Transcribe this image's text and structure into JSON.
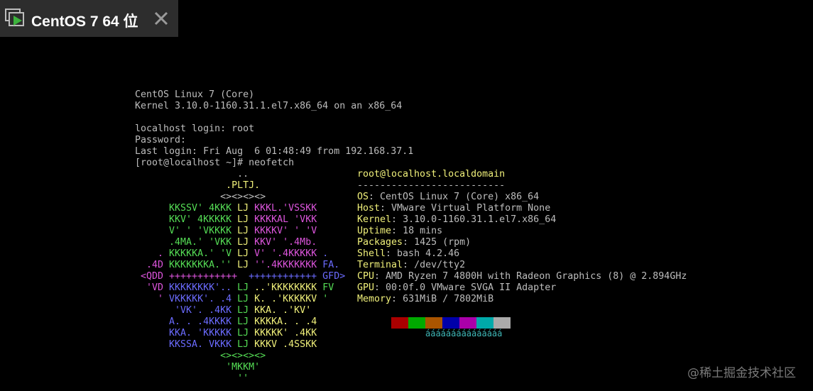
{
  "tab": {
    "title": "CentOS 7 64 位"
  },
  "console": {
    "boot": [
      "CentOS Linux 7 (Core)",
      "Kernel 3.10.0-1160.31.1.el7.x86_64 on an x86_64",
      "localhost login: root",
      "Password:",
      "Last login: Fri Aug  6 01:48:49 from 192.168.37.1",
      "[root@localhost ~]# neofetch"
    ],
    "logo": [
      [
        {
          "c": "gw",
          "t": "                  .."
        }
      ],
      [
        {
          "c": "yel",
          "t": "                .PLTJ."
        }
      ],
      [
        {
          "c": "gw",
          "t": "               <><><><>"
        }
      ],
      [
        {
          "c": "green",
          "t": "      KKSSV' 4KKK "
        },
        {
          "c": "yel",
          "t": "LJ "
        },
        {
          "c": "mag",
          "t": "KKKL.'VSSKK"
        }
      ],
      [
        {
          "c": "green",
          "t": "      KKV' 4KKKKK "
        },
        {
          "c": "yel",
          "t": "LJ "
        },
        {
          "c": "mag",
          "t": "KKKKAL 'VKK"
        }
      ],
      [
        {
          "c": "green",
          "t": "      V' ' 'VKKKK "
        },
        {
          "c": "yel",
          "t": "LJ "
        },
        {
          "c": "mag",
          "t": "KKKKV' ' 'V"
        }
      ],
      [
        {
          "c": "green",
          "t": "      .4MA.' 'VKK "
        },
        {
          "c": "yel",
          "t": "LJ "
        },
        {
          "c": "mag",
          "t": "KKV' '.4Mb."
        }
      ],
      [
        {
          "c": "mag",
          "t": "    . "
        },
        {
          "c": "green",
          "t": "KKKKKA.' 'V "
        },
        {
          "c": "yel",
          "t": "LJ "
        },
        {
          "c": "mag",
          "t": "V' '.4KKKKK "
        },
        {
          "c": "blu",
          "t": "."
        }
      ],
      [
        {
          "c": "mag",
          "t": "  .4D "
        },
        {
          "c": "green",
          "t": "KKKKKKKA.'' "
        },
        {
          "c": "yel",
          "t": "LJ "
        },
        {
          "c": "mag",
          "t": "''.4KKKKKKK "
        },
        {
          "c": "blu",
          "t": "FA."
        }
      ],
      [
        {
          "c": "mag",
          "t": " <QDD ++++++++++++  "
        },
        {
          "c": "blu",
          "t": "++++++++++++ GFD>"
        }
      ],
      [
        {
          "c": "mag",
          "t": "  'VD "
        },
        {
          "c": "blu",
          "t": "KKKKKKKK'.. "
        },
        {
          "c": "green",
          "t": "LJ "
        },
        {
          "c": "yel",
          "t": "..'KKKKKKKK "
        },
        {
          "c": "green",
          "t": "FV"
        }
      ],
      [
        {
          "c": "mag",
          "t": "    ' "
        },
        {
          "c": "blu",
          "t": "VKKKKK'. .4 "
        },
        {
          "c": "green",
          "t": "LJ "
        },
        {
          "c": "yel",
          "t": "K. .'KKKKKV "
        },
        {
          "c": "green",
          "t": "'"
        }
      ],
      [
        {
          "c": "blu",
          "t": "       'VK'. .4KK "
        },
        {
          "c": "green",
          "t": "LJ "
        },
        {
          "c": "yel",
          "t": "KKA. .'KV'"
        }
      ],
      [
        {
          "c": "blu",
          "t": "      A. . .4KKKK "
        },
        {
          "c": "green",
          "t": "LJ "
        },
        {
          "c": "yel",
          "t": "KKKKA. . .4"
        }
      ],
      [
        {
          "c": "blu",
          "t": "      KKA. 'KKKKK "
        },
        {
          "c": "green",
          "t": "LJ "
        },
        {
          "c": "yel",
          "t": "KKKKK' .4KK"
        }
      ],
      [
        {
          "c": "blu",
          "t": "      KKSSA. VKKK "
        },
        {
          "c": "green",
          "t": "LJ "
        },
        {
          "c": "yel",
          "t": "KKKV .4SSKK"
        }
      ],
      [
        {
          "c": "green",
          "t": "               <><><><>"
        }
      ],
      [
        {
          "c": "green",
          "t": "                'MKKM'"
        }
      ],
      [
        {
          "c": "green",
          "t": "                  ''"
        }
      ]
    ],
    "info": {
      "user_host": "root@localhost.localdomain",
      "separator": "--------------------------",
      "rows": [
        {
          "key": "OS",
          "value": "CentOS Linux 7 (Core) x86_64"
        },
        {
          "key": "Host",
          "value": "VMware Virtual Platform None"
        },
        {
          "key": "Kernel",
          "value": "3.10.0-1160.31.1.el7.x86_64"
        },
        {
          "key": "Uptime",
          "value": "18 mins"
        },
        {
          "key": "Packages",
          "value": "1425 (rpm)"
        },
        {
          "key": "Shell",
          "value": "bash 4.2.46"
        },
        {
          "key": "Terminal",
          "value": "/dev/tty2"
        },
        {
          "key": "CPU",
          "value": "AMD Ryzen 7 4800H with Radeon Graphics (8) @ 2.894GHz"
        },
        {
          "key": "GPU",
          "value": "00:0f.0 VMware SVGA II Adapter"
        },
        {
          "key": "Memory",
          "value": "631MiB / 7802MiB"
        }
      ],
      "palette": [
        "#000000",
        "#aa0000",
        "#00aa00",
        "#aa5500",
        "#0000aa",
        "#aa00aa",
        "#00aaaa",
        "#aaaaaa"
      ],
      "palette_bottom": "ááááááááááááááá"
    }
  },
  "watermark": "@稀土掘金技术社区",
  "colors": {
    "background": "#000000",
    "tab_bg": "#2d2d2d",
    "vm_icon_green": "#3db33d"
  }
}
